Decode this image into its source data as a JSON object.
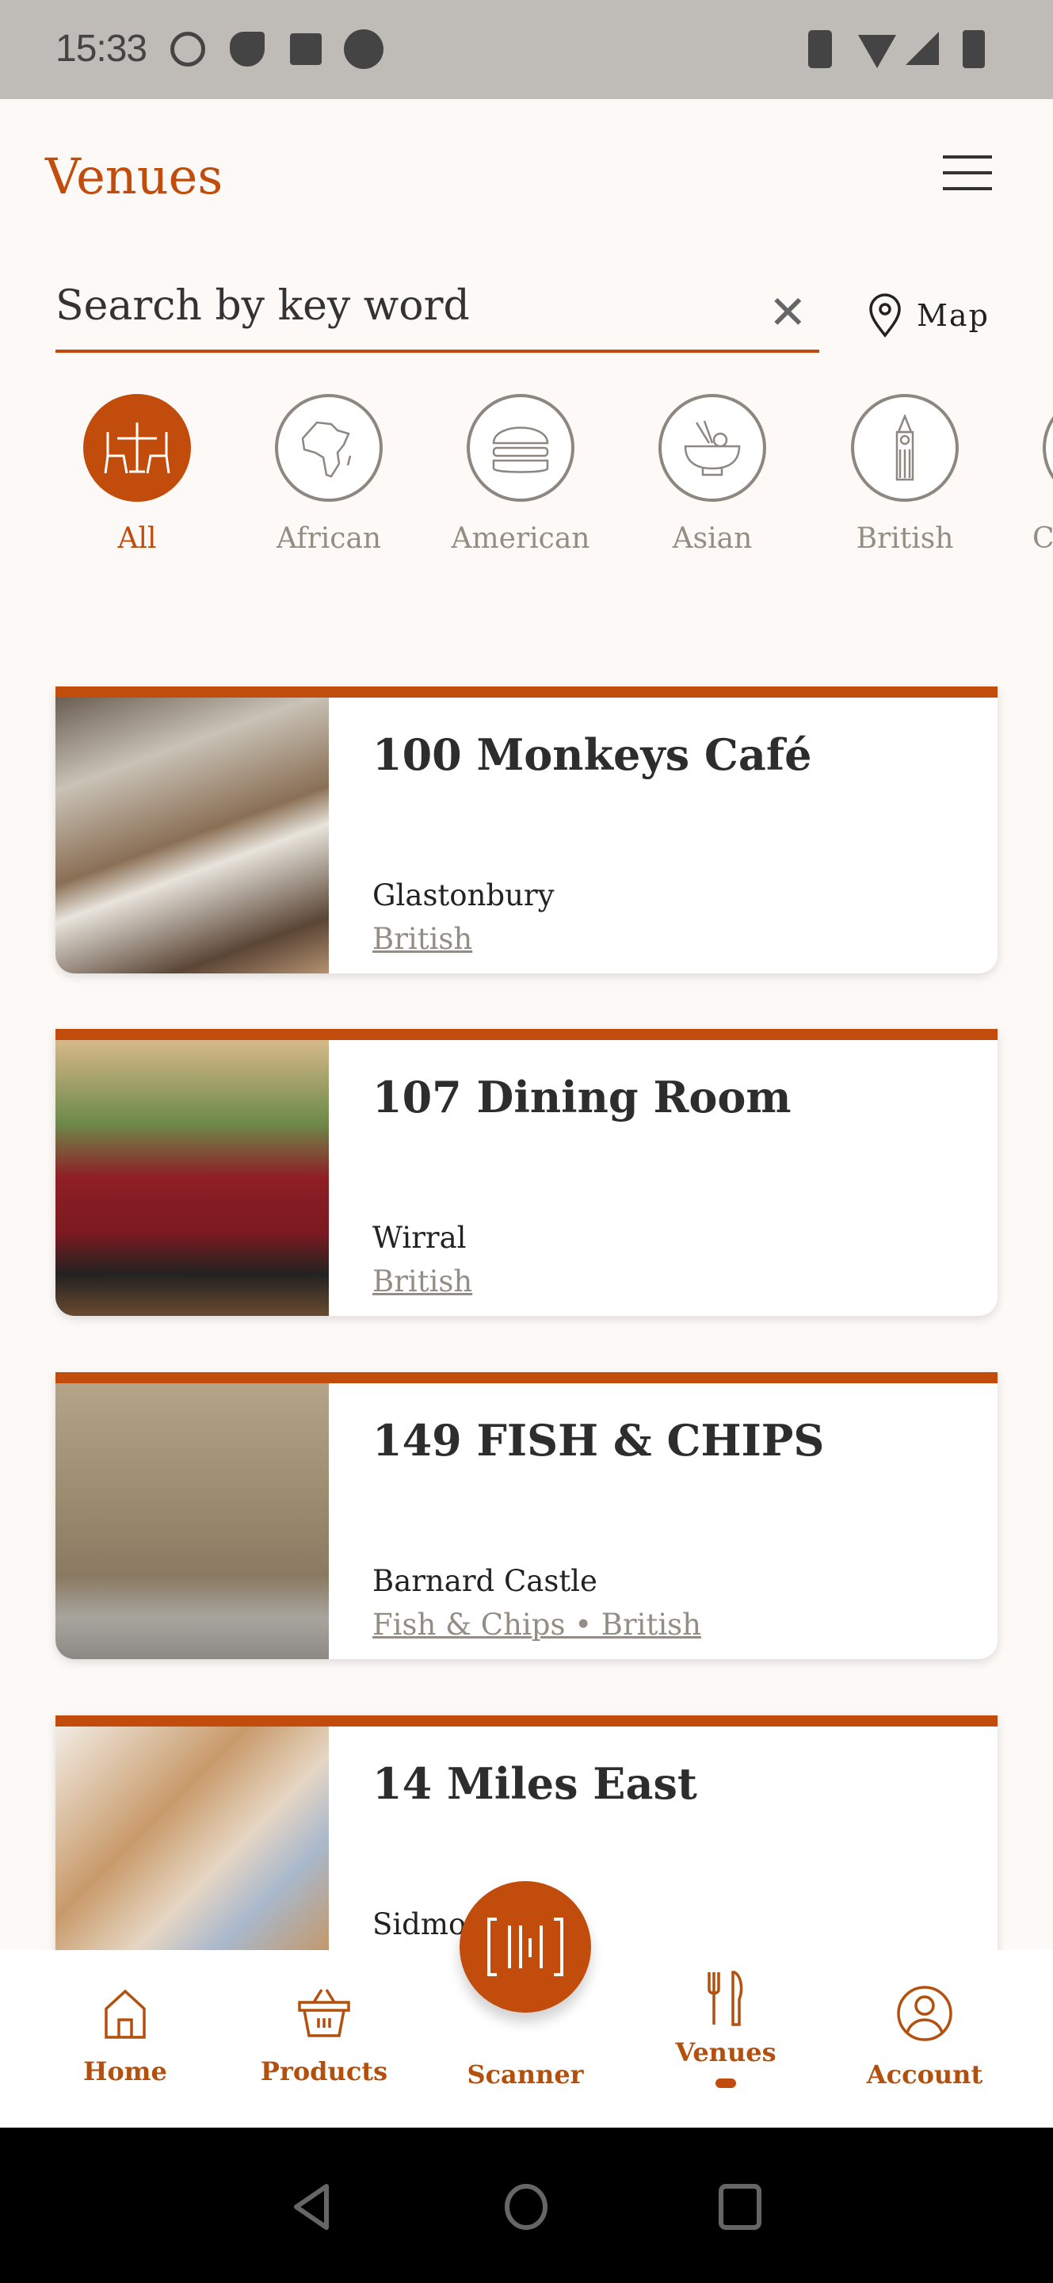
{
  "status_bar": {
    "time": "15:33"
  },
  "header": {
    "title": "Venues"
  },
  "search": {
    "placeholder": "Search by key word",
    "map_label": "Map"
  },
  "categories": [
    {
      "label": "All",
      "icon": "dining-table-icon",
      "active": true
    },
    {
      "label": "African",
      "icon": "africa-map-icon",
      "active": false
    },
    {
      "label": "American",
      "icon": "burger-icon",
      "active": false
    },
    {
      "label": "Asian",
      "icon": "noodle-bowl-icon",
      "active": false
    },
    {
      "label": "British",
      "icon": "big-ben-icon",
      "active": false
    },
    {
      "label": "C",
      "icon": "category-icon",
      "active": false
    }
  ],
  "venues": [
    {
      "name": "100 Monkeys Café",
      "city": "Glastonbury",
      "cuisine": "British"
    },
    {
      "name": "107 Dining Room",
      "city": "Wirral",
      "cuisine": "British"
    },
    {
      "name": "149 FISH & CHIPS",
      "city": "Barnard Castle",
      "cuisine": "Fish & Chips • British"
    },
    {
      "name": "14 Miles East",
      "city": "Sidmouth",
      "cuisine": ""
    }
  ],
  "bottom_nav": [
    {
      "label": "Home",
      "icon": "home-icon"
    },
    {
      "label": "Products",
      "icon": "basket-icon"
    },
    {
      "label": "Scanner",
      "icon": "barcode-scanner-icon"
    },
    {
      "label": "Venues",
      "icon": "fork-knife-icon",
      "active": true
    },
    {
      "label": "Account",
      "icon": "account-icon"
    }
  ],
  "colors": {
    "accent": "#c24c0b",
    "muted": "#948d84",
    "background": "#fcf9f6"
  }
}
